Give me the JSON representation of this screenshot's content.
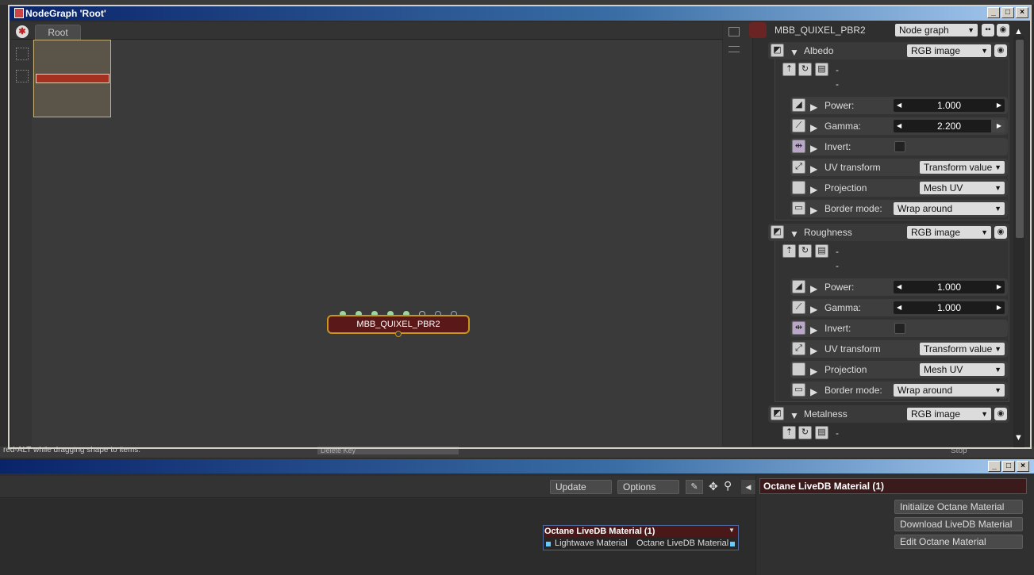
{
  "nodegraph_window": {
    "title": "NodeGraph 'Root'",
    "tab": "Root",
    "node_label": "MBB_QUIXEL_PBR2"
  },
  "inspector": {
    "node_name": "MBB_QUIXEL_PBR2",
    "node_type": "Node graph",
    "sections": [
      {
        "name": "Albedo",
        "type": "RGB image",
        "file_lines": [
          "-",
          "-"
        ],
        "power_label": "Power:",
        "power": "1.000",
        "gamma_label": "Gamma:",
        "gamma": "2.200",
        "invert_label": "Invert:",
        "uv_label": "UV transform",
        "uv_value": "Transform value",
        "proj_label": "Projection",
        "proj_value": "Mesh UV",
        "border_label": "Border mode:",
        "border_value": "Wrap around"
      },
      {
        "name": "Roughness",
        "type": "RGB image",
        "file_lines": [
          "-",
          "-"
        ],
        "power_label": "Power:",
        "power": "1.000",
        "gamma_label": "Gamma:",
        "gamma": "1.000",
        "invert_label": "Invert:",
        "uv_label": "UV transform",
        "uv_value": "Transform value",
        "proj_label": "Projection",
        "proj_value": "Mesh UV",
        "border_label": "Border mode:",
        "border_value": "Wrap around"
      },
      {
        "name": "Metalness",
        "type": "RGB image",
        "file_lines": [
          "-"
        ]
      }
    ]
  },
  "background_fragments": {
    "status_text": "red-ALT while dragging shape to items.",
    "delete_key": "Delete Key",
    "stop": "Stop"
  },
  "bottom_window": {
    "update_button": "Update",
    "options_button": "Options",
    "panel_title": "Octane LiveDB Material (1)",
    "node_title": "Octane LiveDB Material (1)",
    "port_left": "Lightwave Material",
    "port_right": "Octane LiveDB Material",
    "actions": [
      "Initialize Octane Material",
      "Download LiveDB Material",
      "Edit Octane Material"
    ]
  },
  "colors": {
    "node_fill": "#5a1818",
    "node_border": "#c8961e",
    "titlebar": "#0a246a"
  }
}
